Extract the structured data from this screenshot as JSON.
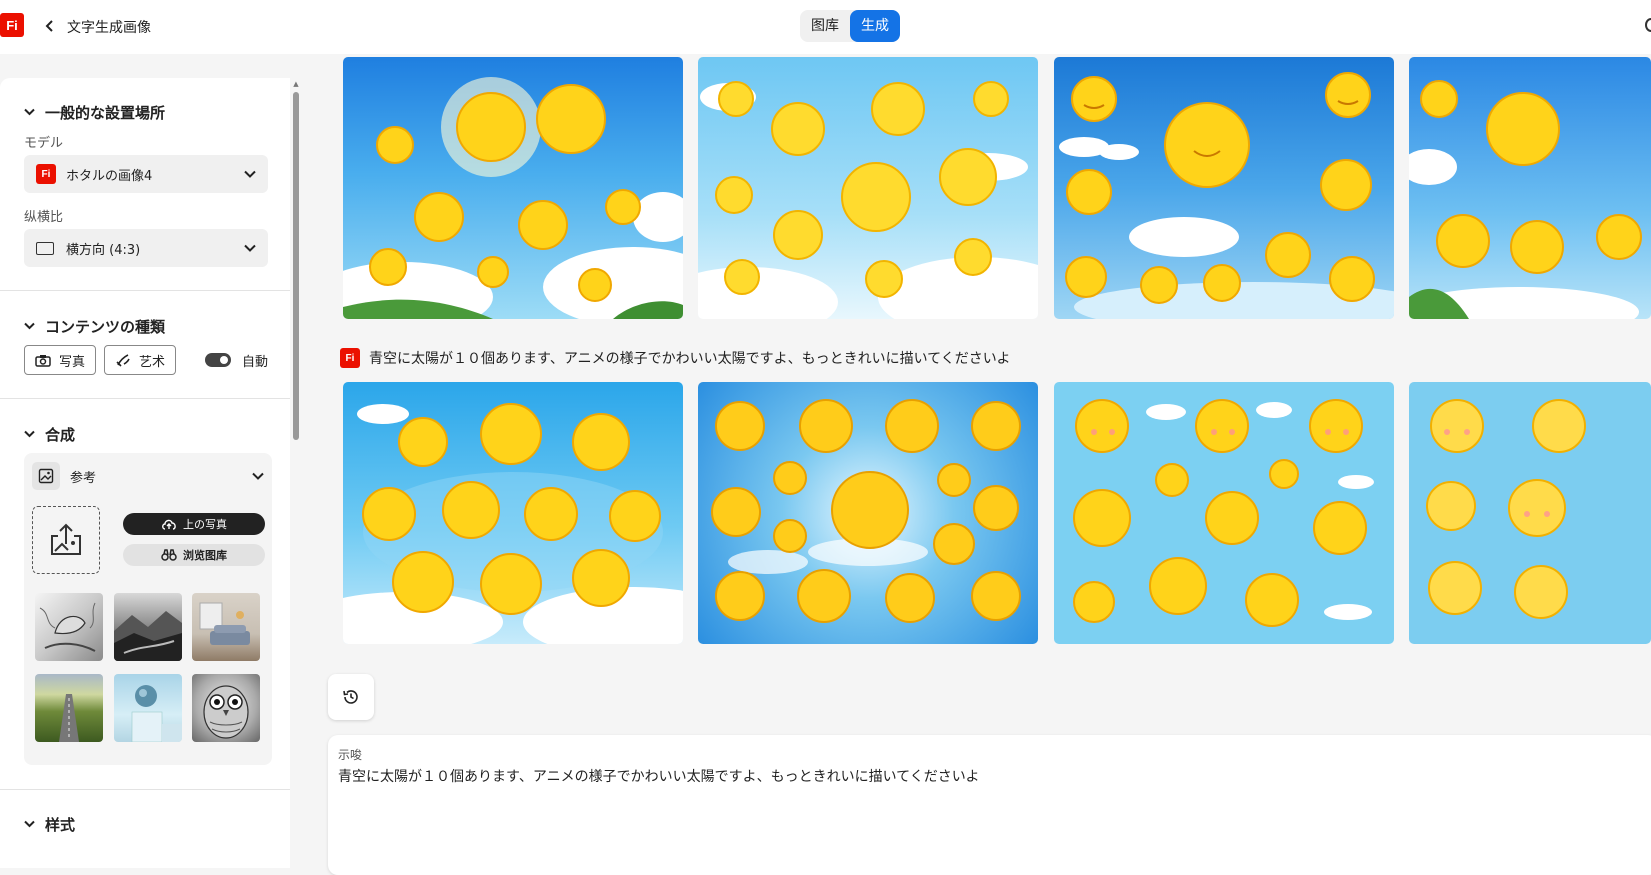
{
  "topbar": {
    "logo_text": "Fi",
    "back_icon": "chevron-left-icon",
    "title": "文字生成画像",
    "tabs": [
      {
        "label": "图库",
        "active": false
      },
      {
        "label": "生成",
        "active": true
      }
    ]
  },
  "sidebar": {
    "general": {
      "heading": "一般的な設置場所",
      "model_label": "モデル",
      "model_badge": "Fi",
      "model_value": "ホタルの画像4",
      "aspect_label": "纵横比",
      "aspect_value": "横方向 (4:3)"
    },
    "content_type": {
      "heading": "コンテンツの種類",
      "photo_label": "写真",
      "art_label": "艺术",
      "auto_label": "自動",
      "auto_on": true
    },
    "composition": {
      "heading": "合成",
      "reference_label": "参考",
      "upload_label": "上の写真",
      "browse_label": "浏览图库",
      "thumbnails": [
        "bird-sketch",
        "misty-mountains",
        "living-room",
        "field-road",
        "sphere-on-cube",
        "owl-sketch"
      ]
    },
    "style": {
      "heading": "样式"
    }
  },
  "main": {
    "prompt_badge": "Fi",
    "prompt_caption": "青空に太陽が１０個あります、アニメの様子でかわいい太陽ですよ、もっときれいに描いてくださいよ",
    "prompt_box_label": "示唆",
    "prompt_box_text": "青空に太陽が１０個あります、アニメの様子でかわいい太陽ですよ、もっときれいに描いてくださいよ",
    "history_icon": "history-icon"
  },
  "colors": {
    "accent": "#1473e6",
    "brand": "#eb1000",
    "sky_light": "#7cd0f2",
    "sky_deep": "#1f8be0",
    "sun": "#ffd31a"
  }
}
